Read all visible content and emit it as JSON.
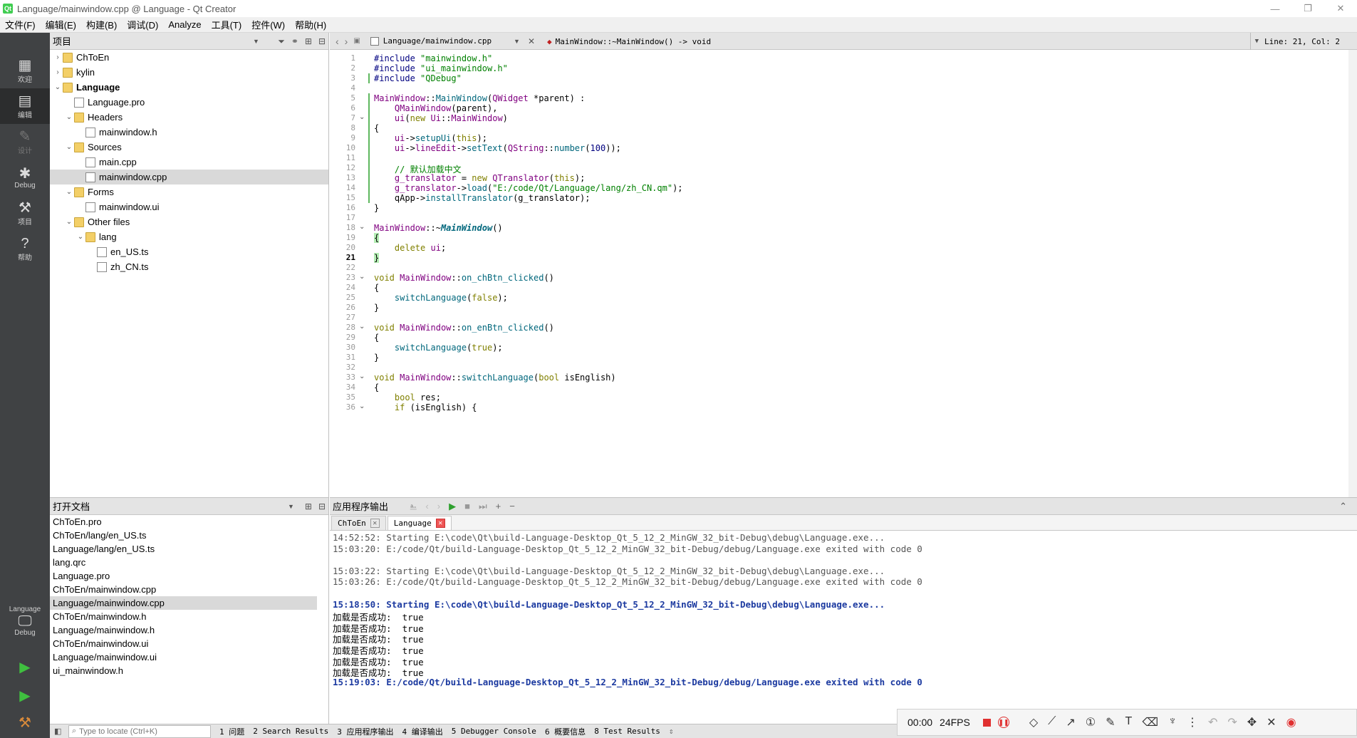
{
  "window": {
    "title": "Language/mainwindow.cpp @ Language - Qt Creator",
    "minimize": "—",
    "restore": "❐",
    "close": "✕"
  },
  "menu": [
    "文件(F)",
    "编辑(E)",
    "构建(B)",
    "调试(D)",
    "Analyze",
    "工具(T)",
    "控件(W)",
    "帮助(H)"
  ],
  "modes": {
    "welcome": "欢迎",
    "edit": "编辑",
    "design": "设计",
    "debug": "Debug",
    "projects": "项目",
    "help": "帮助",
    "kit_project": "Language",
    "kit_build": "Debug"
  },
  "projects_pane": {
    "title": "项目",
    "tree": [
      {
        "label": "ChToEn",
        "level": 0,
        "arrow": "›",
        "icon": "folder",
        "bold": false
      },
      {
        "label": "kylin",
        "level": 0,
        "arrow": "›",
        "icon": "folder",
        "bold": false
      },
      {
        "label": "Language",
        "level": 0,
        "arrow": "⌄",
        "icon": "folder",
        "bold": true
      },
      {
        "label": "Language.pro",
        "level": 1,
        "arrow": "",
        "icon": "file",
        "bold": false
      },
      {
        "label": "Headers",
        "level": 1,
        "arrow": "⌄",
        "icon": "folder",
        "bold": false
      },
      {
        "label": "mainwindow.h",
        "level": 2,
        "arrow": "",
        "icon": "file",
        "bold": false
      },
      {
        "label": "Sources",
        "level": 1,
        "arrow": "⌄",
        "icon": "folder",
        "bold": false
      },
      {
        "label": "main.cpp",
        "level": 2,
        "arrow": "",
        "icon": "file",
        "bold": false
      },
      {
        "label": "mainwindow.cpp",
        "level": 2,
        "arrow": "",
        "icon": "file",
        "bold": false,
        "selected": true
      },
      {
        "label": "Forms",
        "level": 1,
        "arrow": "⌄",
        "icon": "folder",
        "bold": false
      },
      {
        "label": "mainwindow.ui",
        "level": 2,
        "arrow": "",
        "icon": "file",
        "bold": false
      },
      {
        "label": "Other files",
        "level": 1,
        "arrow": "⌄",
        "icon": "folder",
        "bold": false
      },
      {
        "label": "lang",
        "level": 2,
        "arrow": "⌄",
        "icon": "folder",
        "bold": false
      },
      {
        "label": "en_US.ts",
        "level": 3,
        "arrow": "",
        "icon": "file",
        "bold": false
      },
      {
        "label": "zh_CN.ts",
        "level": 3,
        "arrow": "",
        "icon": "file",
        "bold": false
      }
    ]
  },
  "open_docs": {
    "title": "打开文档",
    "items": [
      "ChToEn.pro",
      "ChToEn/lang/en_US.ts",
      "Language/lang/en_US.ts",
      "lang.qrc",
      "Language.pro",
      "ChToEn/mainwindow.cpp",
      "Language/mainwindow.cpp",
      "ChToEn/mainwindow.h",
      "Language/mainwindow.h",
      "ChToEn/mainwindow.ui",
      "Language/mainwindow.ui",
      "ui_mainwindow.h"
    ],
    "selected_index": 6
  },
  "editor": {
    "file": "Language/mainwindow.cpp",
    "symbol": "MainWindow::~MainWindow() -> void",
    "position": "Line: 21, Col: 2",
    "current_line": 21,
    "folds": [
      7,
      18,
      23,
      28,
      33,
      36
    ],
    "code": [
      [
        [
          "pp",
          "#include "
        ],
        [
          "str",
          "\"mainwindow.h\""
        ]
      ],
      [
        [
          "pp",
          "#include "
        ],
        [
          "str",
          "\"ui_mainwindow.h\""
        ]
      ],
      [
        [
          "pp",
          "#include "
        ],
        [
          "str",
          "\"QDebug\""
        ]
      ],
      [],
      [
        [
          "ty",
          "MainWindow"
        ],
        [
          "",
          "::"
        ],
        [
          "fn",
          "MainWindow"
        ],
        [
          "",
          "("
        ],
        [
          "ty",
          "QWidget"
        ],
        [
          "",
          " *parent) :"
        ]
      ],
      [
        [
          "",
          "    "
        ],
        [
          "ty",
          "QMainWindow"
        ],
        [
          "",
          "(parent),"
        ]
      ],
      [
        [
          "",
          "    "
        ],
        [
          "ty",
          "ui"
        ],
        [
          "",
          "("
        ],
        [
          "kw",
          "new"
        ],
        [
          "",
          " "
        ],
        [
          "ty",
          "Ui"
        ],
        [
          "",
          "::"
        ],
        [
          "ty",
          "MainWindow"
        ],
        [
          "",
          ")"
        ]
      ],
      [
        [
          "",
          "{"
        ]
      ],
      [
        [
          "",
          "    "
        ],
        [
          "ty",
          "ui"
        ],
        [
          "",
          "->"
        ],
        [
          "fn",
          "setupUi"
        ],
        [
          "",
          "("
        ],
        [
          "kw",
          "this"
        ],
        [
          "",
          ");"
        ]
      ],
      [
        [
          "",
          "    "
        ],
        [
          "ty",
          "ui"
        ],
        [
          "",
          "->"
        ],
        [
          "ty",
          "lineEdit"
        ],
        [
          "",
          "->"
        ],
        [
          "fn",
          "setText"
        ],
        [
          "",
          "("
        ],
        [
          "ty",
          "QString"
        ],
        [
          "",
          "::"
        ],
        [
          "fn",
          "number"
        ],
        [
          "",
          "("
        ],
        [
          "num",
          "100"
        ],
        [
          "",
          "));"
        ]
      ],
      [],
      [
        [
          "cm",
          "    // 默认加载中文"
        ]
      ],
      [
        [
          "",
          "    "
        ],
        [
          "ty",
          "g_translator"
        ],
        [
          "",
          " = "
        ],
        [
          "kw",
          "new"
        ],
        [
          "",
          " "
        ],
        [
          "ty",
          "QTranslator"
        ],
        [
          "",
          "("
        ],
        [
          "kw",
          "this"
        ],
        [
          "",
          ");"
        ]
      ],
      [
        [
          "",
          "    "
        ],
        [
          "ty",
          "g_translator"
        ],
        [
          "",
          "->"
        ],
        [
          "fn",
          "load"
        ],
        [
          "",
          "("
        ],
        [
          "str",
          "\"E:/code/Qt/Language/lang/zh_CN.qm\""
        ],
        [
          "",
          ");"
        ]
      ],
      [
        [
          "",
          "    qApp->"
        ],
        [
          "fn",
          "installTranslator"
        ],
        [
          "",
          "(g_translator);"
        ]
      ],
      [
        [
          "",
          "}"
        ]
      ],
      [],
      [
        [
          "ty",
          "MainWindow"
        ],
        [
          "",
          "::~"
        ],
        [
          "it",
          "MainWindow"
        ],
        [
          "",
          "()"
        ]
      ],
      [
        [
          "br",
          "{"
        ]
      ],
      [
        [
          "",
          "    "
        ],
        [
          "kw",
          "delete"
        ],
        [
          "",
          " "
        ],
        [
          "ty",
          "ui"
        ],
        [
          "",
          ";"
        ]
      ],
      [
        [
          "br",
          "}"
        ]
      ],
      [],
      [
        [
          "kw",
          "void"
        ],
        [
          "",
          " "
        ],
        [
          "ty",
          "MainWindow"
        ],
        [
          "",
          "::"
        ],
        [
          "fn",
          "on_chBtn_clicked"
        ],
        [
          "",
          "()"
        ]
      ],
      [
        [
          "",
          "{"
        ]
      ],
      [
        [
          "",
          "    "
        ],
        [
          "fn",
          "switchLanguage"
        ],
        [
          "",
          "("
        ],
        [
          "kw",
          "false"
        ],
        [
          "",
          ");"
        ]
      ],
      [
        [
          "",
          "}"
        ]
      ],
      [],
      [
        [
          "kw",
          "void"
        ],
        [
          "",
          " "
        ],
        [
          "ty",
          "MainWindow"
        ],
        [
          "",
          "::"
        ],
        [
          "fn",
          "on_enBtn_clicked"
        ],
        [
          "",
          "()"
        ]
      ],
      [
        [
          "",
          "{"
        ]
      ],
      [
        [
          "",
          "    "
        ],
        [
          "fn",
          "switchLanguage"
        ],
        [
          "",
          "("
        ],
        [
          "kw",
          "true"
        ],
        [
          "",
          ");"
        ]
      ],
      [
        [
          "",
          "}"
        ]
      ],
      [],
      [
        [
          "kw",
          "void"
        ],
        [
          "",
          " "
        ],
        [
          "ty",
          "MainWindow"
        ],
        [
          "",
          "::"
        ],
        [
          "fn",
          "switchLanguage"
        ],
        [
          "",
          "("
        ],
        [
          "kw",
          "bool"
        ],
        [
          "",
          " isEnglish)"
        ]
      ],
      [
        [
          "",
          "{"
        ]
      ],
      [
        [
          "",
          "    "
        ],
        [
          "kw",
          "bool"
        ],
        [
          "",
          " res;"
        ]
      ],
      [
        [
          "",
          "    "
        ],
        [
          "kw",
          "if"
        ],
        [
          "",
          " (isEnglish) {"
        ]
      ]
    ]
  },
  "output": {
    "title": "应用程序输出",
    "tabs": [
      "ChToEn",
      "Language"
    ],
    "active_tab": 1,
    "lines": [
      {
        "text": "14:52:52: Starting E:\\code\\Qt\\build-Language-Desktop_Qt_5_12_2_MinGW_32_bit-Debug\\debug\\Language.exe...",
        "style": "gray"
      },
      {
        "text": "15:03:20: E:/code/Qt/build-Language-Desktop_Qt_5_12_2_MinGW_32_bit-Debug/debug/Language.exe exited with code 0",
        "style": "gray"
      },
      {
        "text": "",
        "style": "gray"
      },
      {
        "text": "15:03:22: Starting E:\\code\\Qt\\build-Language-Desktop_Qt_5_12_2_MinGW_32_bit-Debug\\debug\\Language.exe...",
        "style": "gray"
      },
      {
        "text": "15:03:26: E:/code/Qt/build-Language-Desktop_Qt_5_12_2_MinGW_32_bit-Debug/debug/Language.exe exited with code 0",
        "style": "gray"
      },
      {
        "text": "",
        "style": "gray"
      },
      {
        "text": "15:18:50: Starting E:\\code\\Qt\\build-Language-Desktop_Qt_5_12_2_MinGW_32_bit-Debug\\debug\\Language.exe...",
        "style": "blue"
      },
      {
        "text": "加载是否成功:  true",
        "style": "plain"
      },
      {
        "text": "加载是否成功:  true",
        "style": "plain"
      },
      {
        "text": "加载是否成功:  true",
        "style": "plain"
      },
      {
        "text": "加载是否成功:  true",
        "style": "plain"
      },
      {
        "text": "加载是否成功:  true",
        "style": "plain"
      },
      {
        "text": "加载是否成功:  true",
        "style": "plain"
      },
      {
        "text": "15:19:03: E:/code/Qt/build-Language-Desktop_Qt_5_12_2_MinGW_32_bit-Debug/debug/Language.exe exited with code 0",
        "style": "blue"
      }
    ]
  },
  "statusbar": {
    "locate_placeholder": "Type to locate (Ctrl+K)",
    "items": [
      "1 问题",
      "2 Search Results",
      "3 应用程序输出",
      "4 编译输出",
      "5 Debugger Console",
      "6 概要信息",
      "8 Test Results"
    ]
  },
  "recorder": {
    "time": "00:00",
    "fps": "24FPS"
  },
  "colors": {
    "modebar": "#404244",
    "keyword": "#808000",
    "type": "#800080",
    "string": "#008000",
    "function": "#00677c",
    "output_blue": "#1c3aa0"
  }
}
